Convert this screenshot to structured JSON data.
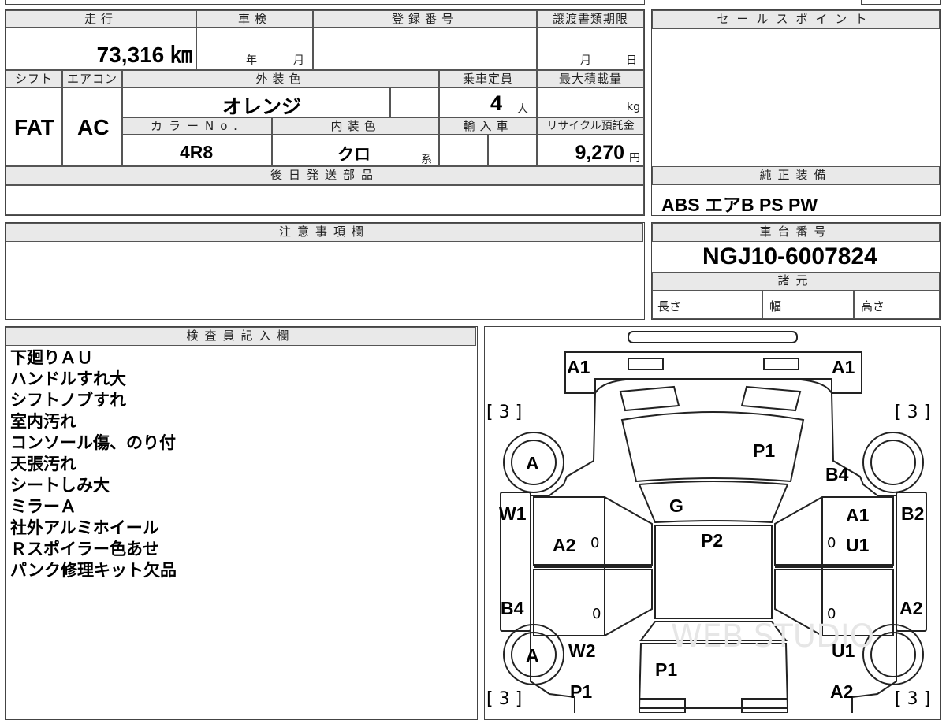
{
  "top_summary": {
    "mileage_label": "走行",
    "mileage_value": "73,316 ㎞",
    "inspection_label": "車検",
    "inspection_year_unit": "年",
    "inspection_month_unit": "月",
    "registration_label": "登録番号",
    "transfer_deadline_label": "譲渡書類期限",
    "transfer_month_unit": "月",
    "transfer_day_unit": "日",
    "shift_label": "シフト",
    "shift_value": "FAT",
    "aircon_label": "エアコン",
    "aircon_value": "AC",
    "exterior_color_label": "外装色",
    "exterior_color_value": "オレンジ",
    "capacity_label": "乗車定員",
    "capacity_value": "4",
    "capacity_unit": "人",
    "max_load_label": "最大積載量",
    "max_load_unit": "kg",
    "color_no_label": "カラーNo.",
    "color_no_value": "4R8",
    "interior_color_label": "内装色",
    "interior_color_value": "クロ",
    "interior_color_suffix": "系",
    "import_label": "輸入車",
    "recycle_label": "リサイクル預託金",
    "recycle_value": "9,270",
    "recycle_unit": "円",
    "later_parts_label": "後日発送部品",
    "notes_label": "注意事項欄"
  },
  "side_panel": {
    "sales_point_label": "セールスポイント",
    "standard_equipment_label": "純正装備",
    "standard_equipment_value": "ABS エアB PS PW",
    "chassis_no_label": "車台番号",
    "chassis_no_value": "NGJ10-6007824",
    "specs_label": "諸元",
    "length_label": "長さ",
    "width_label": "幅",
    "height_label": "高さ"
  },
  "inspector": {
    "label": "検査員記入欄",
    "notes": [
      "下廻りＡＵ",
      "ハンドルすれ大",
      "シフトノブすれ",
      "室内汚れ",
      "コンソール傷、のり付",
      "天張汚れ",
      "シートしみ大",
      "ミラーＡ",
      "社外アルミホイール",
      "Ｒスポイラー色あせ",
      "パンク修理キット欠品"
    ]
  },
  "diagram": {
    "front_left": "A1",
    "front_right": "A1",
    "tire_front_left_bracket": "[ 3 ]",
    "tire_front_right_bracket": "[ 3 ]",
    "tire_rear_left_bracket": "[ 3 ]",
    "tire_rear_right_bracket": "[ 3 ]",
    "wheel_front_left": "A",
    "wheel_rear_left": "A",
    "hood": "P1",
    "front_right_fender": "B4",
    "windshield": "G",
    "roof": "P2",
    "left_front_fender_side": "W1",
    "left_front_door": "A2",
    "right_front_door_top": "A1",
    "right_front_door": "U1",
    "right_front_fender_side": "B2",
    "left_rear_side": "B4",
    "right_rear_side": "A2",
    "left_rear_quarter": "W2",
    "trunk": "P1",
    "left_rear_bumper": "P1",
    "right_rear_quarter": "U1",
    "right_rear_bumper": "A2",
    "door_mark": "0",
    "watermark": "WEB STUDIO"
  }
}
